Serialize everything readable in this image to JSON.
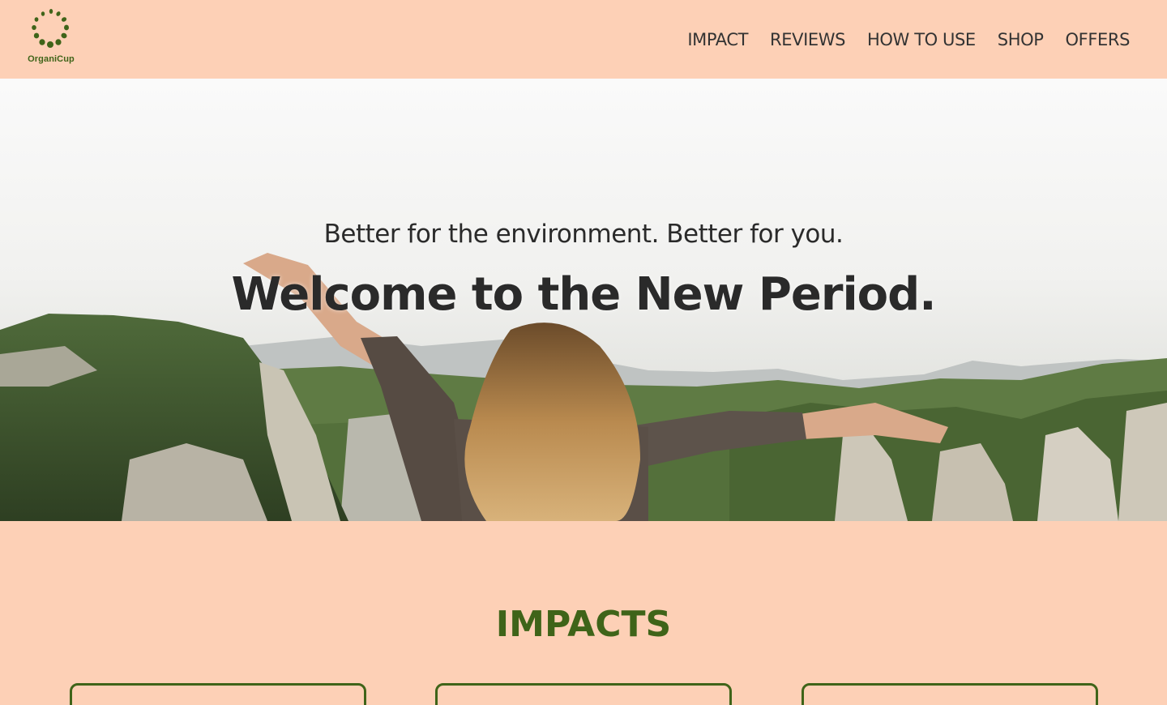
{
  "header": {
    "logo_text": "OrganiCup",
    "nav": [
      "IMPACT",
      "REVIEWS",
      "HOW TO USE",
      "SHOP",
      "OFFERS"
    ]
  },
  "hero": {
    "subtitle": "Better for the environment. Better for you.",
    "title": "Welcome to the New Period."
  },
  "impacts": {
    "title": "IMPACTS"
  },
  "colors": {
    "background": "#fdd0b6",
    "brand_green": "#3f6419",
    "text_dark": "#2c2c2c"
  }
}
